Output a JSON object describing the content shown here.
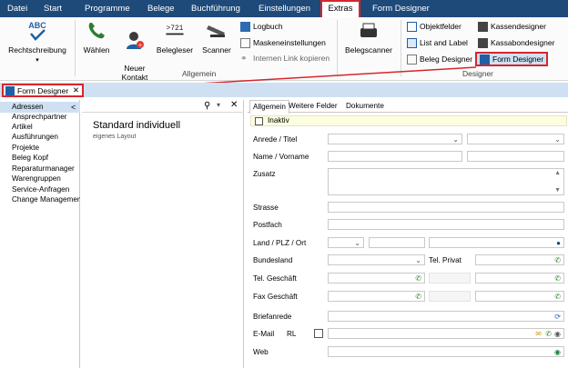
{
  "menubar": {
    "items": [
      "Datei",
      "Start",
      "Programme",
      "Belege",
      "Buchführung",
      "Einstellungen",
      "Extras",
      "Form Designer"
    ],
    "active": "Extras"
  },
  "ribbon": {
    "rechtschreibung_icon_text": "ABC",
    "rechtschreibung": "Rechtschreibung",
    "waehlen": "Wählen",
    "neuer_kontakt": "Neuer\nKontakt",
    "belegleser_icon_text": ">721",
    "belegleser": "Belegleser",
    "scanner": "Scanner",
    "logbuch": "Logbuch",
    "maskeneinstellungen": "Maskeneinstellungen",
    "internen_link": "Internen Link kopieren",
    "group_allgemein": "Allgemein",
    "belegscanner": "Belegscanner",
    "objektfelder": "Objektfelder",
    "list_and_label": "List and Label",
    "beleg_designer": "Beleg Designer",
    "kassendesigner": "Kassendesigner",
    "kassabondesigner": "Kassabondesigner",
    "form_designer": "Form Designer",
    "group_designer": "Designer"
  },
  "fd_tab": {
    "label": "Form Designer",
    "close": "✕"
  },
  "leftnav": {
    "collapse_glyph": "<",
    "items": [
      "Adressen",
      "Ansprechpartner",
      "Artikel",
      "Ausführungen",
      "Projekte",
      "Beleg Kopf",
      "Reparaturmanager",
      "Warengruppen",
      "Service-Anfragen",
      "Change Managemen"
    ],
    "selected": "Adressen"
  },
  "midpanel": {
    "layout_title": "Standard individuell",
    "layout_subtitle": "eigenes Layout"
  },
  "form": {
    "tabs": [
      "Allgemein",
      "Weitere Felder",
      "Dokumente"
    ],
    "active_tab": "Allgemein",
    "inaktiv": "Inaktiv",
    "labels": {
      "anrede": "Anrede / Titel",
      "name": "Name / Vorname",
      "zusatz": "Zusatz",
      "strasse": "Strasse",
      "postfach": "Postfach",
      "land": "Land / PLZ / Ort",
      "bundesland": "Bundesland",
      "tel_privat": "Tel. Privat",
      "tel_geschaeft": "Tel. Geschäft",
      "fax_geschaeft": "Fax Geschäft",
      "briefanrede": "Briefanrede",
      "email": "E-Mail",
      "rl": "RL",
      "web": "Web"
    }
  },
  "colors": {
    "menubar": "#1e4a7a",
    "highlight": "#d6262c",
    "strip": "#cfe0f2",
    "inaktiv_bg": "#fdfde0",
    "phone_green": "#2e8b2e"
  }
}
